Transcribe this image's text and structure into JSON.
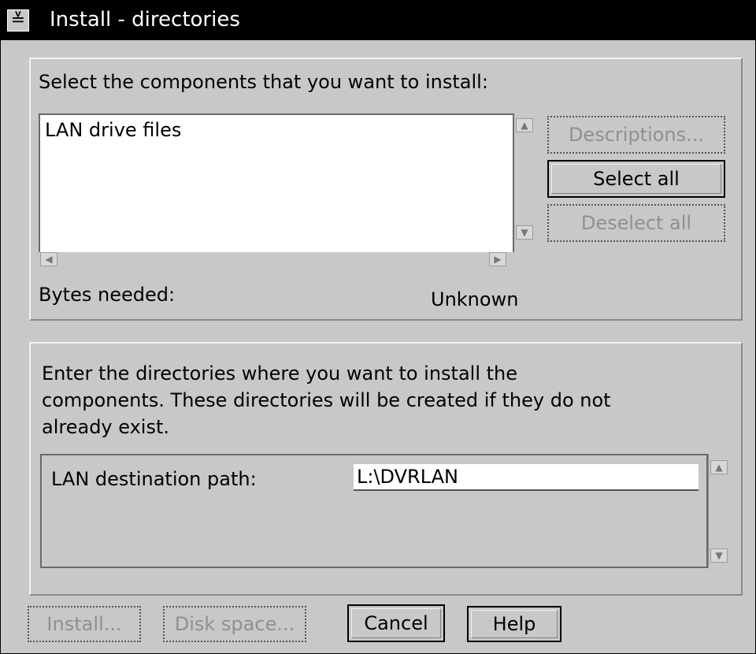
{
  "window": {
    "title": "Install - directories",
    "system_menu_icon": "system-menu-icon"
  },
  "components": {
    "prompt": "Select the components that you want to install:",
    "list_items": [
      "LAN drive files"
    ],
    "descriptions_label": "Descriptions...",
    "select_all_label": "Select all",
    "deselect_all_label": "Deselect all",
    "bytes_needed_label": "Bytes needed:",
    "bytes_needed_value": "Unknown"
  },
  "directories": {
    "prompt_line1": "Enter the directories where you want to install the",
    "prompt_line2": "components.  These directories will be created if they do not",
    "prompt_line3": "already exist.",
    "lan_path_label": "LAN destination path:",
    "lan_path_value": "L:\\DVRLAN"
  },
  "footer": {
    "install_label": "Install...",
    "disk_space_label": "Disk space...",
    "cancel_label": "Cancel",
    "help_label": "Help"
  }
}
